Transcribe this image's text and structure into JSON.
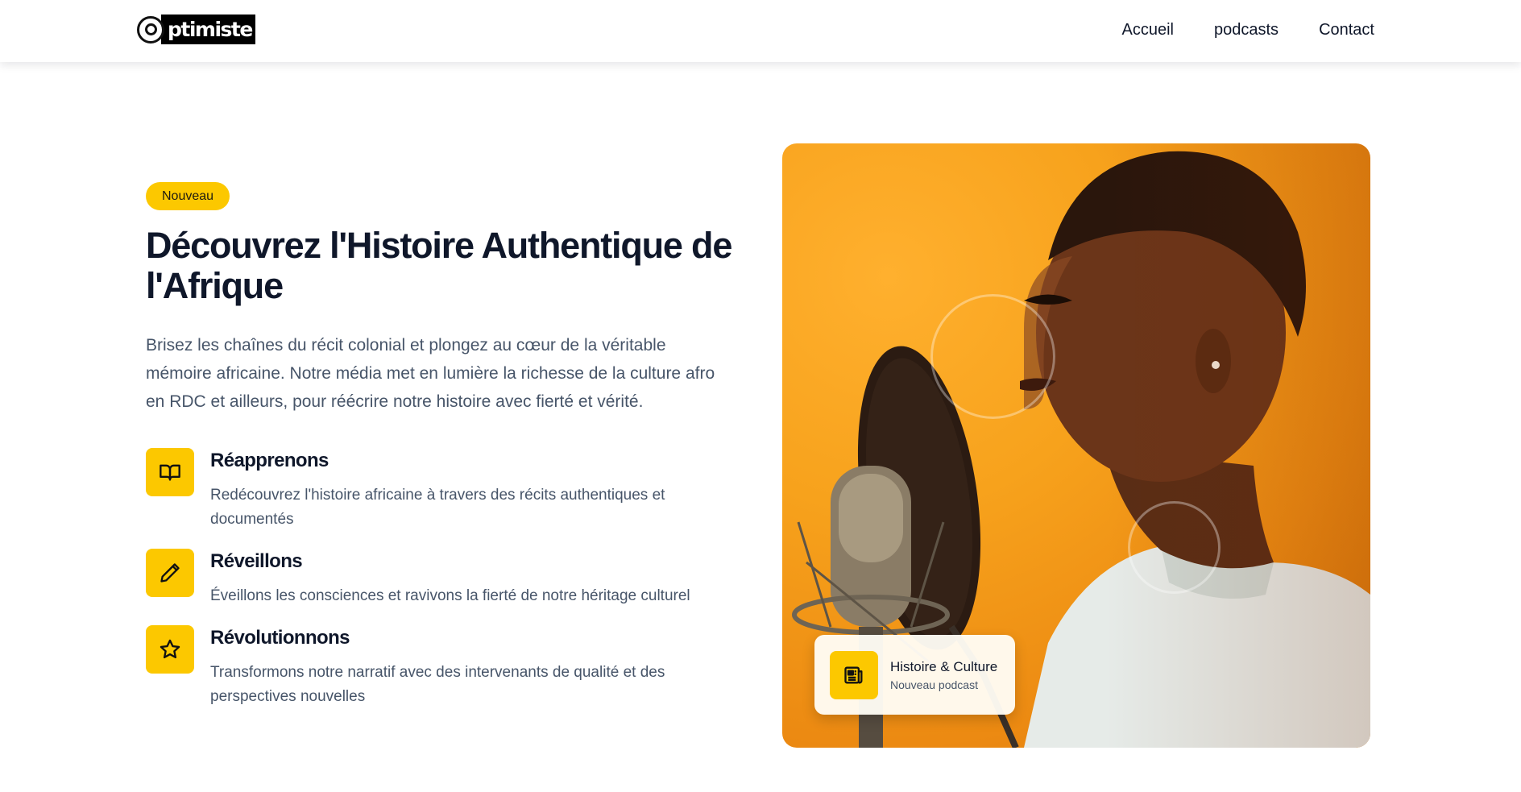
{
  "header": {
    "logo_mark_text": "O",
    "logo_text": "ptimiste",
    "nav": [
      "Accueil",
      "podcasts",
      "Contact"
    ]
  },
  "hero": {
    "badge": "Nouveau",
    "title": "Découvrez l'Histoire Authentique de l'Afrique",
    "description": "Brisez les chaînes du récit colonial et plongez au cœur de la véritable mémoire africaine. Notre média met en lumière la richesse de la culture afro en RDC et ailleurs, pour réécrire notre histoire avec fierté et vérité.",
    "features": [
      {
        "icon": "book-open-icon",
        "title": "Réapprenons",
        "text": "Redécouvrez l'histoire africaine à travers des récits authentiques et documentés"
      },
      {
        "icon": "pencil-icon",
        "title": "Réveillons",
        "text": "Éveillons les consciences et ravivons la fierté de notre héritage culturel"
      },
      {
        "icon": "star-icon",
        "title": "Révolutionnons",
        "text": "Transformons notre narratif avec des intervenants de qualité et des perspectives nouvelles"
      }
    ]
  },
  "image_card": {
    "icon": "newspaper-icon",
    "title": "Histoire & Culture",
    "subtitle": "Nouveau podcast"
  },
  "colors": {
    "accent": "#fcc800",
    "text_dark": "#0f172a",
    "text_muted": "#475569",
    "image_background": "#f39a17"
  }
}
